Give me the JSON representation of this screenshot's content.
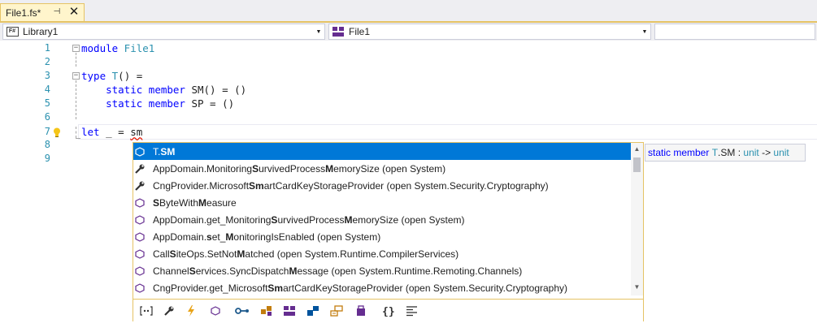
{
  "tab": {
    "title": "File1.fs*",
    "pin_glyph": "⊣",
    "close_glyph": "✕"
  },
  "navbar": {
    "project": "Library1",
    "project_icon": "F#",
    "scope": "File1",
    "member": ""
  },
  "editor": {
    "line_numbers": [
      "1",
      "2",
      "3",
      "4",
      "5",
      "6",
      "7",
      "8",
      "9"
    ],
    "lines": {
      "l1_kw": "module",
      "l1_name": " File1",
      "l3_kw": "type",
      "l3_ty": " T",
      "l3_rest": "() =",
      "l4_indent": "    ",
      "l4_kw1": "static",
      "l4_sp": " ",
      "l4_kw2": "member",
      "l4_rest": " SM() = ()",
      "l5_indent": "    ",
      "l5_kw1": "static",
      "l5_sp": " ",
      "l5_kw2": "member",
      "l5_rest": " SP = ()",
      "l7_kw": "let",
      "l7_rest": " _ = ",
      "l7_typed": "sm"
    },
    "fold_glyph": "−"
  },
  "completion": {
    "items": [
      {
        "parts": [
          "T.",
          "SM",
          ""
        ],
        "icon": "method-icon",
        "selected": true
      },
      {
        "parts": [
          "AppDomain.Monitoring",
          "S",
          "urvivedProcess",
          "M",
          "emorySize (open System)"
        ],
        "icon": "property-icon"
      },
      {
        "parts": [
          "CngProvider.Microsoft",
          "Sm",
          "artCardKeyStorageProvider (open System.Security.Cryptography)"
        ],
        "icon": "property-icon"
      },
      {
        "parts": [
          "",
          "S",
          "ByteWith",
          "M",
          "easure"
        ],
        "icon": "method-icon"
      },
      {
        "parts": [
          "AppDomain.get_Monitoring",
          "S",
          "urvivedProcess",
          "M",
          "emorySize (open System)"
        ],
        "icon": "method-icon"
      },
      {
        "parts": [
          "AppDomain.",
          "s",
          "et_",
          "M",
          "onitoringIsEnabled (open System)"
        ],
        "icon": "method-icon"
      },
      {
        "parts": [
          "Call",
          "S",
          "iteOps.SetNot",
          "M",
          "atched (open System.Runtime.CompilerServices)"
        ],
        "icon": "method-icon"
      },
      {
        "parts": [
          "Channel",
          "S",
          "ervices.SyncDispatch",
          "M",
          "essage (open System.Runtime.Remoting.Channels)"
        ],
        "icon": "method-icon"
      },
      {
        "parts": [
          "CngProvider.get_Microsoft",
          "Sm",
          "artCardKeyStorageProvider (open System.Security.Cryptography)"
        ],
        "icon": "method-icon"
      }
    ],
    "filters": [
      "namespace-filter-icon",
      "property-filter-icon",
      "event-filter-icon",
      "method-filter-icon",
      "interface-filter-icon",
      "type-filter-icon",
      "class-filter-icon",
      "struct-filter-icon",
      "enum-filter-icon",
      "module-filter-icon",
      "braces-filter-icon",
      "keyword-filter-icon"
    ]
  },
  "tooltip": {
    "kw": "static member",
    "sp": " ",
    "ty": "T",
    "name": ".SM : ",
    "unit1": "unit",
    "arrow": " -> ",
    "unit2": "unit"
  },
  "colors": {
    "accent": "#0078d7",
    "keyword": "#0000ff",
    "type": "#2b91af",
    "tab_bg": "#fff5cc",
    "popup_border": "#e5c365",
    "icon_purple": "#652d90"
  }
}
